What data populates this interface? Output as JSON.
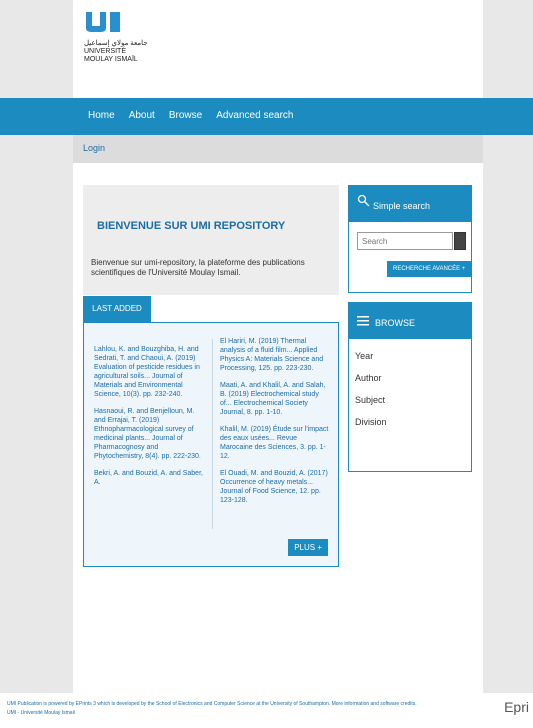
{
  "logo": {
    "name": "umi",
    "tagline_lines": [
      "جامعة مولاي إسماعيل",
      "UNIVERSITÉ",
      "MOULAY ISMAÏL"
    ]
  },
  "nav": {
    "items": [
      "Home",
      "About",
      "Browse",
      "Advanced search"
    ]
  },
  "subnav": {
    "login": "Login"
  },
  "welcome": {
    "title": "BIENVENUE SUR UMI REPOSITORY",
    "text": "Bienvenue sur umi-repository, la plateforme des publications scientifiques de l'Université Moulay Ismail."
  },
  "latest": {
    "tab_label": "LAST ADDED",
    "left_items": [
      "Lahlou, K. and Bouzghiba, H. and Sedrati, T. and Chaoui, A. (2019) Evaluation of pesticide residues in agricultural soils... Journal of Materials and Environmental Science, 10(3). pp. 232-240.",
      "Hasnaoui, R. and Benjelloun, M. and Errajai, T. (2019) Ethnopharmacological survey of medicinal plants... Journal of Pharmacognosy and Phytochemistry, 8(4). pp. 222-230.",
      "Bekri, A. and Bouzid, A. and Saber, A."
    ],
    "right_items": [
      "El Hariri, M. (2019) Thermal analysis of a fluid film... Applied Physics A: Materials Science and Processing, 125. pp. 223-230.",
      "Maati, A. and Khalil, A. and Salah, B. (2019) Electrochemical study of... Electrochemical Society Journal, 8. pp. 1-10.",
      "Khalil, M. (2019) Étude sur l'impact des eaux usées... Revue Marocaine des Sciences, 3. pp. 1-12.",
      "El Ouadi, M. and Bouzid, A. (2017) Occurrence of heavy metals... Journal of Food Science, 12. pp. 123-128."
    ],
    "more_label": "PLUS +"
  },
  "search": {
    "title": "Simple search",
    "placeholder": "Search",
    "advanced_label": "RECHERCHE AVANCÉE +"
  },
  "browse": {
    "title": "BROWSE",
    "items": [
      "Year",
      "Author",
      "Subject",
      "Division"
    ]
  },
  "footer": {
    "line1": "UMI Publication is powered by EPrints 3 which is developed by the School of Electronics and Computer Science at the University of Southampton. More information and software credits.",
    "line2": "UMI - Université Moulay Ismail",
    "brand": "Epri"
  },
  "colors": {
    "primary": "#1c8cc0",
    "link": "#1c6ca6"
  }
}
